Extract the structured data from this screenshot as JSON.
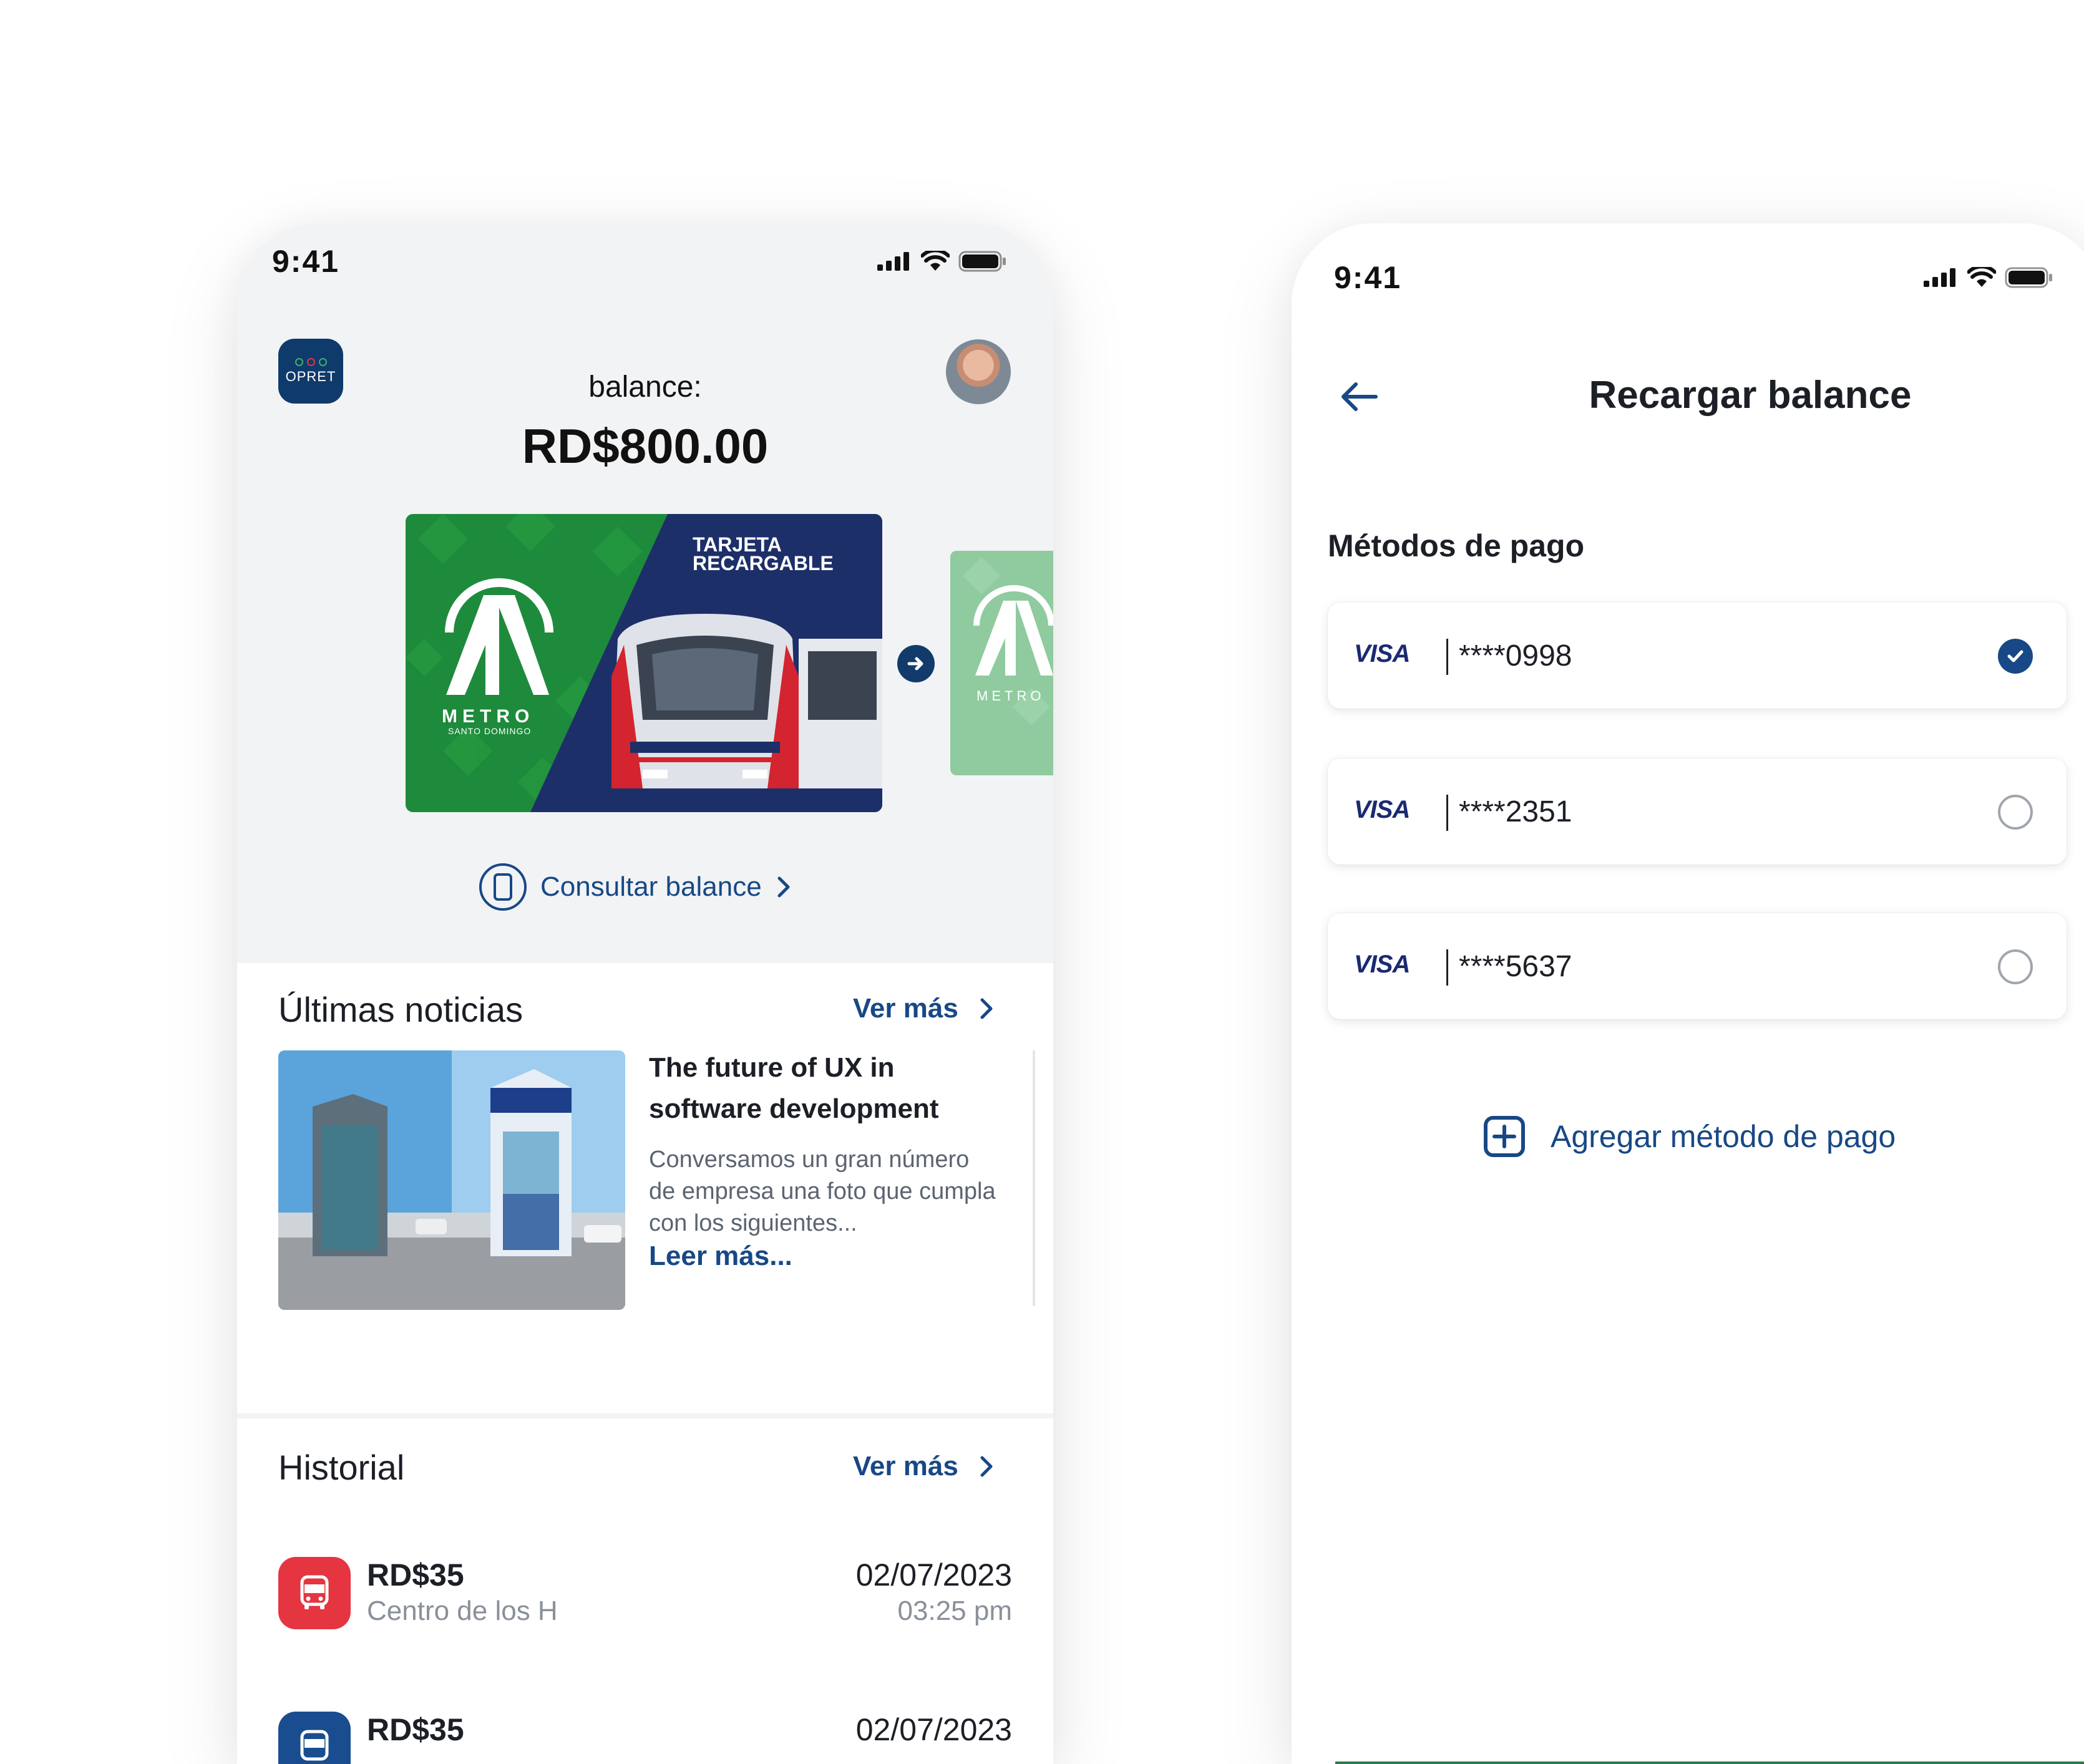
{
  "home": {
    "status_time": "9:41",
    "logo_text": "OPRET",
    "balance_label": "balance:",
    "balance_amount": "RD$800.00",
    "card": {
      "title_line1": "TARJETA",
      "title_line2": "RECARGABLE",
      "brand": "METRO",
      "brand_sub": "SANTO DOMINGO"
    },
    "consult_label": "Consultar balance",
    "news": {
      "title": "Últimas noticias",
      "ver_mas": "Ver más",
      "item_title": "The future of UX in software development",
      "item_body": "Conversamos un gran número de empresa una foto que cumpla con  los siguientes...",
      "item_more": "Leer más..."
    },
    "history": {
      "title": "Historial",
      "ver_mas": "Ver más",
      "rows": [
        {
          "amount": "RD$35",
          "place": "Centro de los H",
          "date": "02/07/2023",
          "time": "03:25 pm",
          "color": "#e53540"
        },
        {
          "amount": "RD$35",
          "place": "",
          "date": "02/07/2023",
          "time": "",
          "color": "#1a4d8f"
        }
      ]
    }
  },
  "recharge": {
    "status_time": "9:41",
    "title": "Recargar balance",
    "section_title": "Métodos de pago",
    "methods": [
      {
        "brand": "VISA",
        "number": "****0998",
        "selected": true
      },
      {
        "brand": "VISA",
        "number": "****2351",
        "selected": false
      },
      {
        "brand": "VISA",
        "number": "****5637",
        "selected": false
      }
    ],
    "add_label": "Agregar método de pago"
  },
  "colors": {
    "primary": "#184886",
    "navy": "#123b6b",
    "card_green": "#1e8a3c",
    "card_navy": "#1d2f68",
    "bus_red": "#e53540"
  },
  "icons": [
    "signal-icon",
    "wifi-icon",
    "battery-icon",
    "arrow-right-icon",
    "card-icon",
    "chevron-right-icon",
    "bus-icon",
    "back-arrow-icon",
    "check-icon",
    "plus-square-icon"
  ]
}
